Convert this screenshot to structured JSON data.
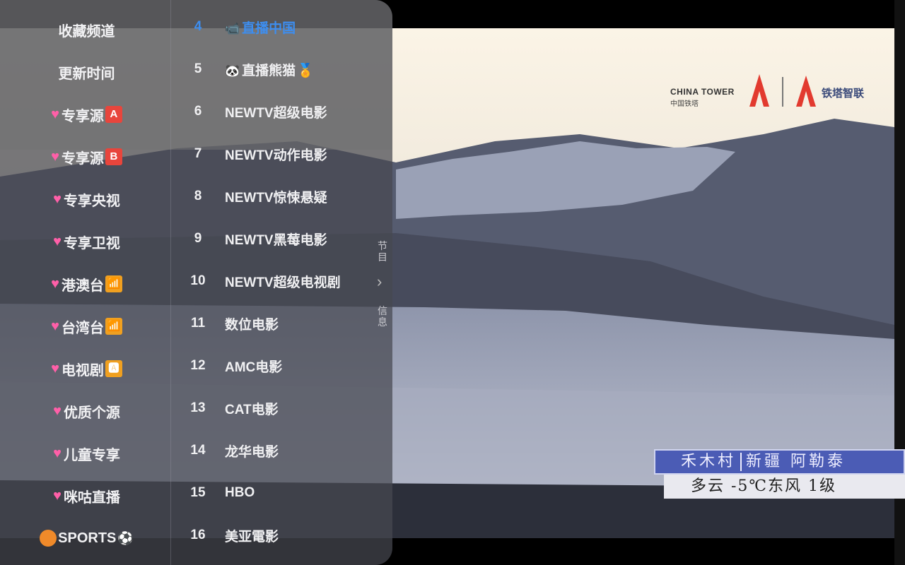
{
  "categories": [
    {
      "label": "收藏频道",
      "heart": false
    },
    {
      "label": "更新时间",
      "heart": false
    },
    {
      "label": "专享源",
      "heart": true,
      "badge": "A",
      "badge_color": "#e8453c",
      "selected": true
    },
    {
      "label": "专享源",
      "heart": true,
      "badge": "B",
      "badge_color": "#e8453c"
    },
    {
      "label": "专享央视",
      "heart": true
    },
    {
      "label": "专享卫视",
      "heart": true
    },
    {
      "label": "港澳台",
      "heart": true,
      "badge": "📶",
      "badge_color": "#f0a020"
    },
    {
      "label": "台湾台",
      "heart": true,
      "badge": "📶",
      "badge_color": "#f0a020"
    },
    {
      "label": "电视剧",
      "heart": true,
      "badge": "🅰",
      "badge_color": "#f0a020"
    },
    {
      "label": "优质个源",
      "heart": true
    },
    {
      "label": "儿童专享",
      "heart": true
    },
    {
      "label": "咪咕直播",
      "heart": true
    },
    {
      "label": "SPORTS",
      "sports": true
    }
  ],
  "channels": [
    {
      "num": "4",
      "name": "直播中国",
      "icon": "📹",
      "active": true
    },
    {
      "num": "5",
      "name": "直播熊猫",
      "icon": "🐼",
      "medal": "🏅"
    },
    {
      "num": "6",
      "name": "NEWTV超级电影"
    },
    {
      "num": "7",
      "name": "NEWTV动作电影"
    },
    {
      "num": "8",
      "name": "NEWTV惊悚悬疑"
    },
    {
      "num": "9",
      "name": "NEWTV黑莓电影"
    },
    {
      "num": "10",
      "name": "NEWTV超级电视剧"
    },
    {
      "num": "11",
      "name": "数位电影"
    },
    {
      "num": "12",
      "name": "AMC电影"
    },
    {
      "num": "13",
      "name": "CAT电影"
    },
    {
      "num": "14",
      "name": "龙华电影"
    },
    {
      "num": "15",
      "name": "HBO"
    },
    {
      "num": "16",
      "name": "美亚電影"
    }
  ],
  "side": {
    "top_label": "节目",
    "bottom_label": "信息",
    "arrow": "›"
  },
  "broadcast": {
    "logo_en": "CHINA TOWER",
    "logo_cn": "中国铁塔",
    "logo_cn2": "铁塔智联",
    "location_a": "禾木村",
    "location_b": "新疆 阿勒泰",
    "weather": "多云 -5℃东风 1级"
  }
}
